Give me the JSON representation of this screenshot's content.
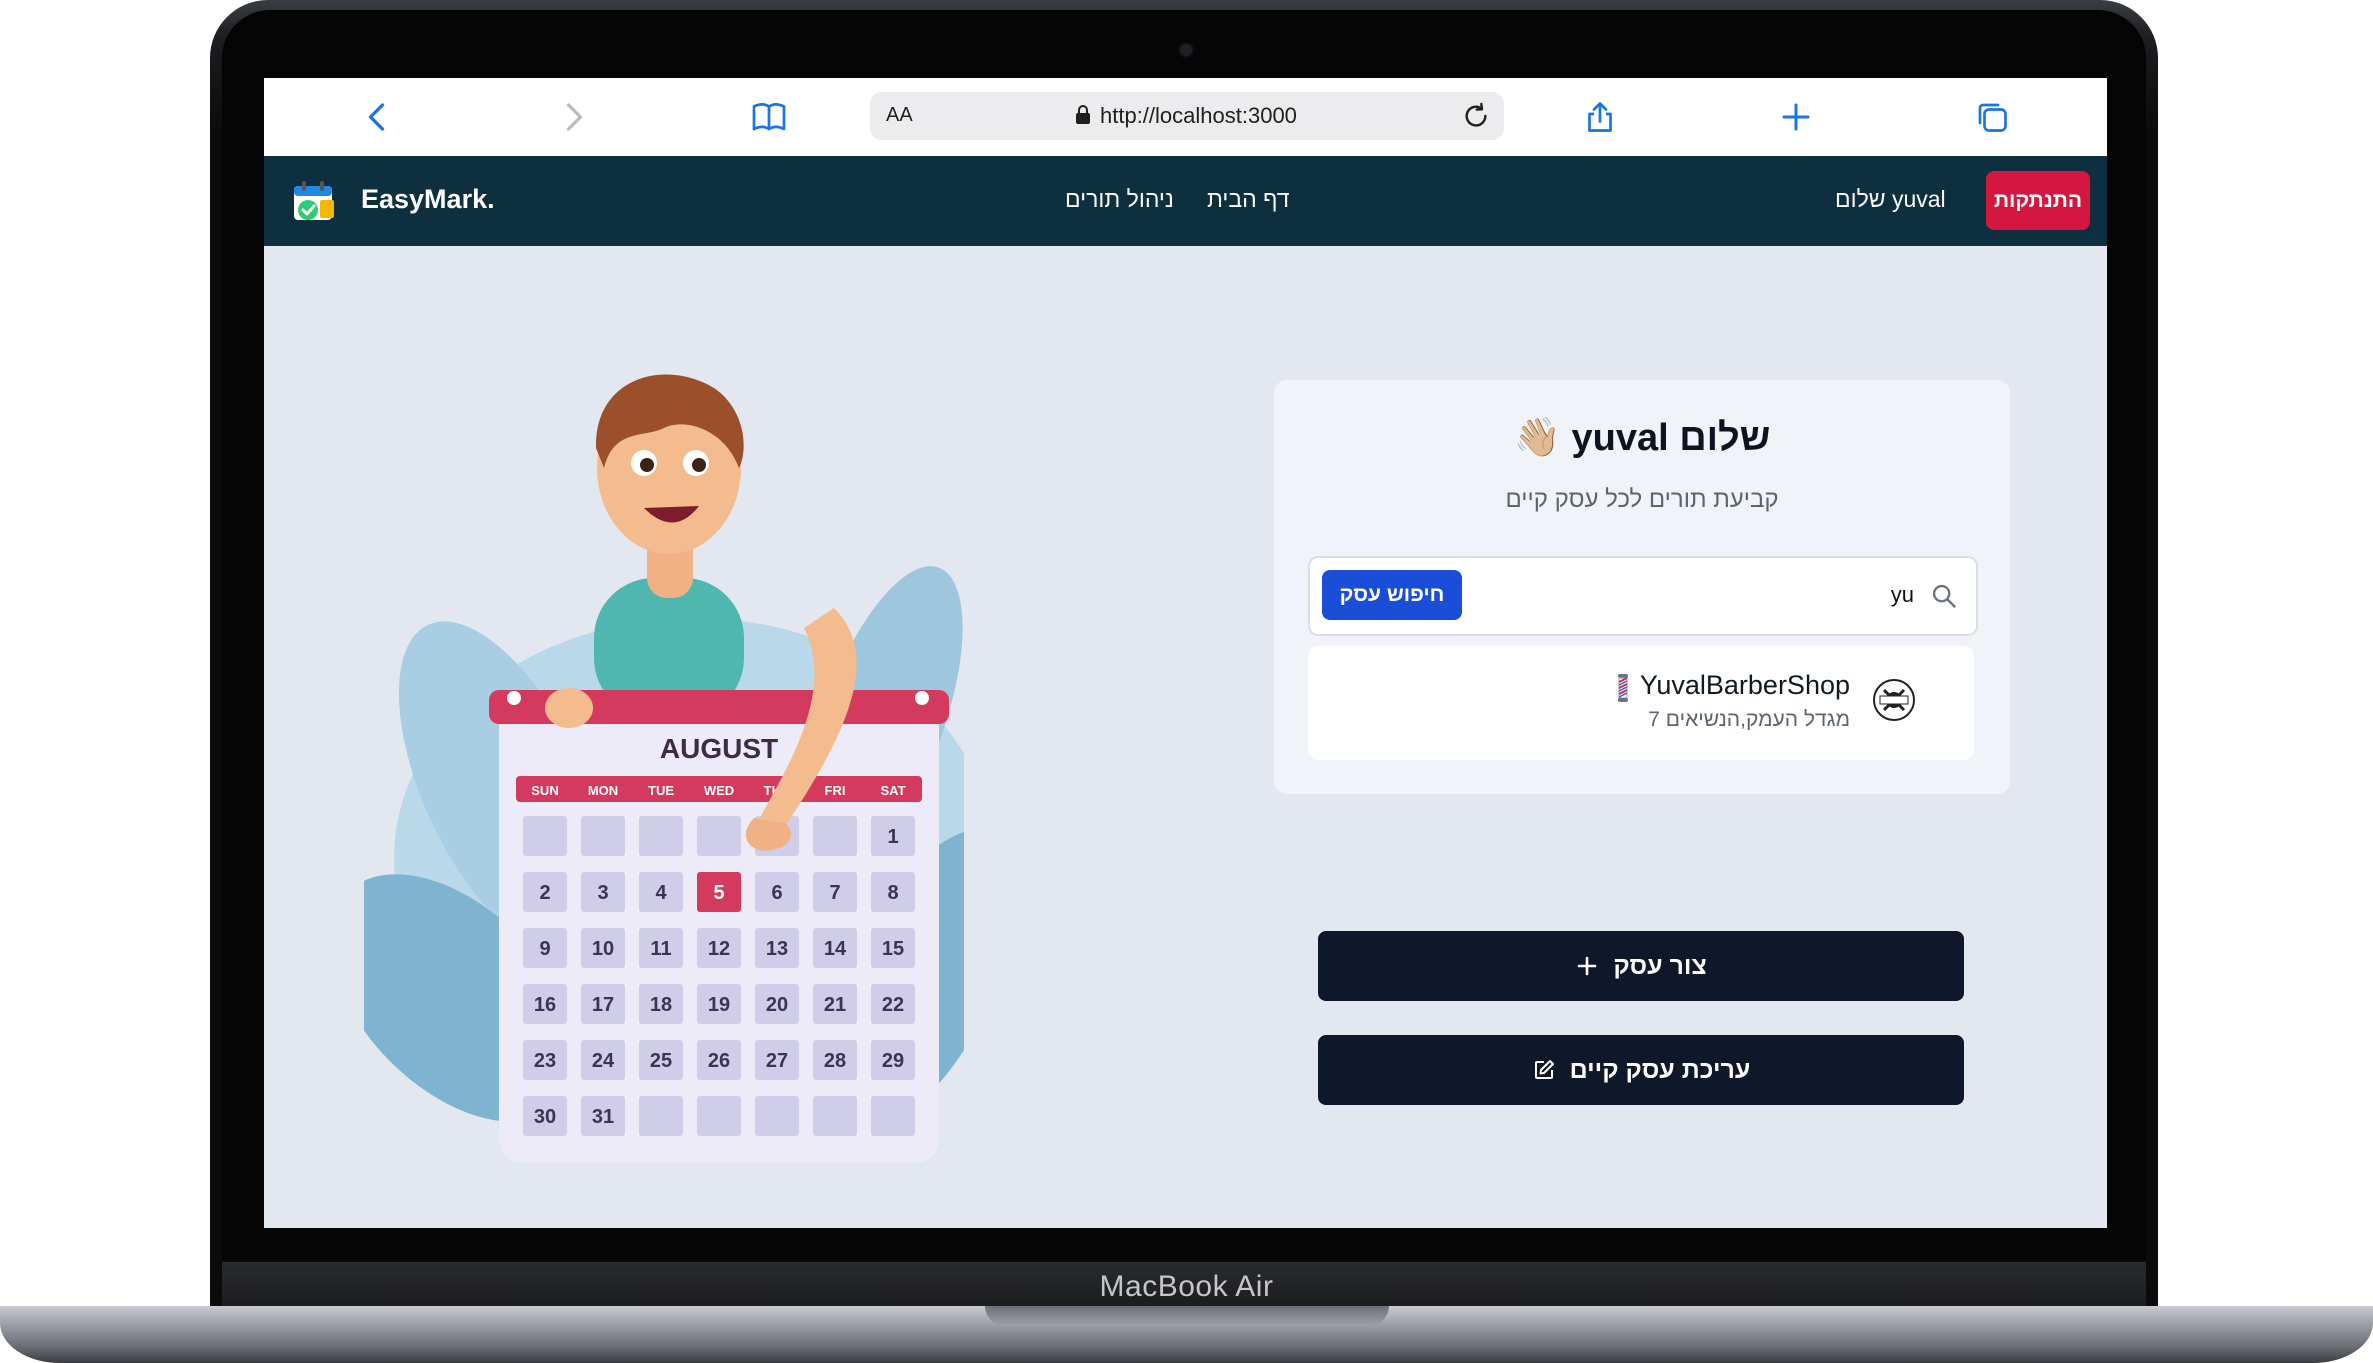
{
  "device": {
    "label": "MacBook Air"
  },
  "browser": {
    "aa_label": "AA",
    "url": "http://localhost:3000",
    "icons": [
      "back-icon",
      "forward-icon",
      "bookmarks-icon",
      "lock-icon",
      "reload-icon",
      "share-icon",
      "new-tab-icon",
      "tabs-icon"
    ]
  },
  "nav": {
    "brand": "EasyMark.",
    "links": {
      "home": "דף הבית",
      "manage": "ניהול תורים"
    },
    "user_greeting": "yuval שלום",
    "logout_label": "התנתקות"
  },
  "illustration": {
    "month": "AUGUST",
    "weekdays": [
      "SUN",
      "MON",
      "TUE",
      "WED",
      "THU",
      "FRI",
      "SAT"
    ],
    "highlighted_day": "5",
    "days": [
      "1",
      "2",
      "3",
      "4",
      "5",
      "6",
      "7",
      "8",
      "9",
      "10",
      "11",
      "12",
      "13",
      "14",
      "15",
      "16",
      "17",
      "18",
      "19",
      "20",
      "21",
      "22",
      "23",
      "24",
      "25",
      "26",
      "27",
      "28",
      "29",
      "30",
      "31"
    ]
  },
  "card": {
    "greeting": "שלום yuval 👋🏼",
    "subtitle": "קביעת תורים לכל עסק קיים",
    "search": {
      "value": "yu",
      "button_label": "חיפוש עסק"
    },
    "results": [
      {
        "name": "YuvalBarberShop",
        "address": "מגדל העמק,הנשיאים 7"
      }
    ]
  },
  "actions": {
    "create_label": "צור עסק",
    "edit_label": "עריכת עסק קיים"
  },
  "colors": {
    "navbar": "#0d2f3f",
    "logout": "#d4173f",
    "search_button": "#1a4ed8",
    "action_button": "#0f172a",
    "page_bg": "#e3e8f0",
    "calendar_accent": "#d33a5e"
  }
}
